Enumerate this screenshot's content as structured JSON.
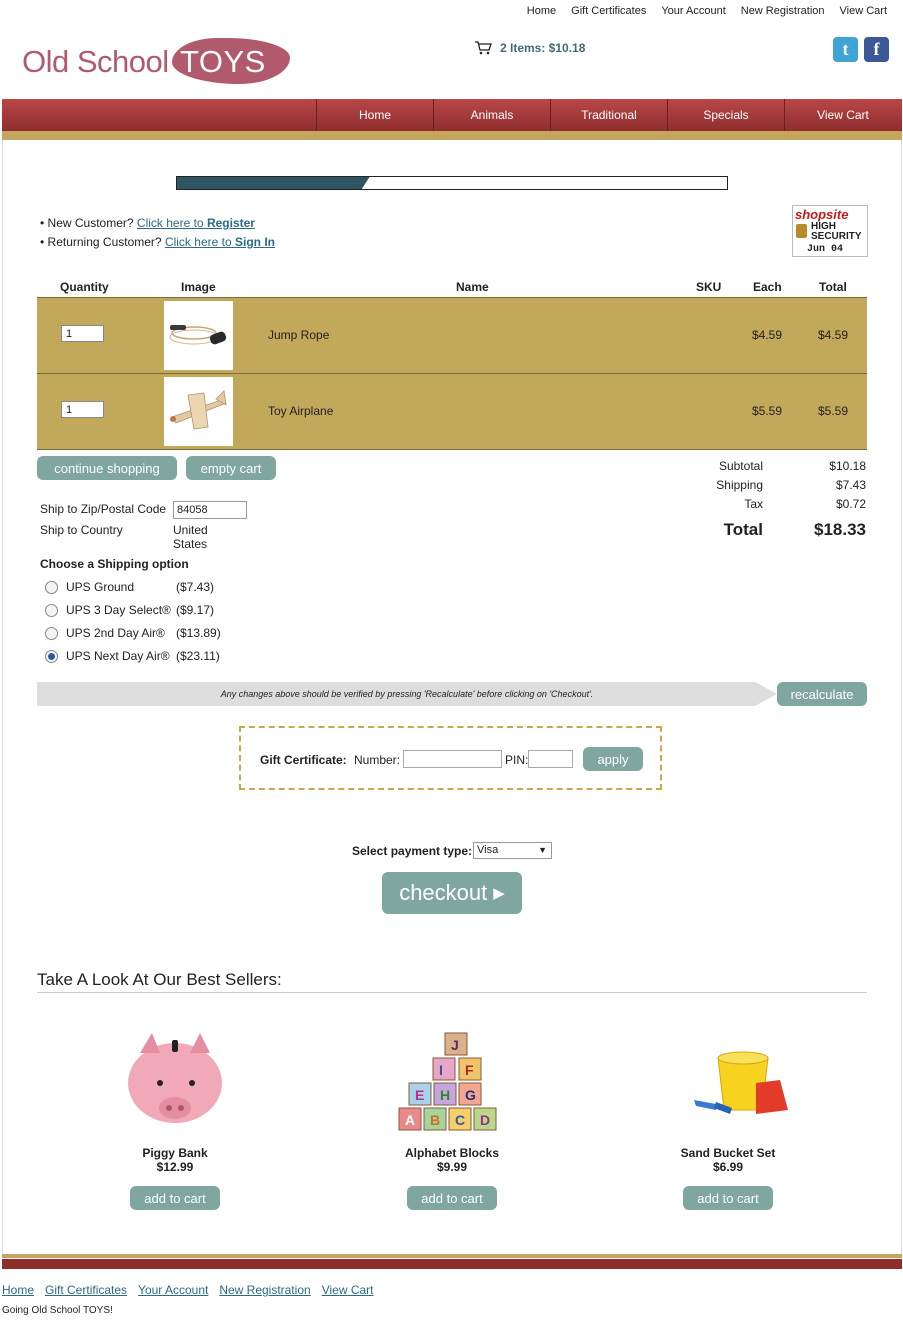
{
  "header": {
    "top_links": [
      "Home",
      "Gift Certificates",
      "Your Account",
      "New Registration",
      "View Cart"
    ],
    "logo_old": "Old School",
    "logo_toys": "TOYS",
    "cart_summary": "2 Items: $10.18"
  },
  "nav": [
    "Home",
    "Animals",
    "Traditional",
    "Specials",
    "View Cart"
  ],
  "progress": {
    "fraction": 0.35
  },
  "customer": {
    "new_prefix": "• New Customer?",
    "new_link": "Click here to",
    "new_link_bold": "Register",
    "return_prefix": "• Returning Customer?",
    "return_link": "Click here to",
    "return_link_bold": "Sign In"
  },
  "badge": {
    "brand": "shopsite",
    "line1": "HIGH",
    "line2": "SECURITY",
    "date": "Jun 04"
  },
  "table": {
    "headers": {
      "quantity": "Quantity",
      "image": "Image",
      "name": "Name",
      "sku": "SKU",
      "each": "Each",
      "total": "Total"
    },
    "rows": [
      {
        "qty": "1",
        "name": "Jump Rope",
        "each": "$4.59",
        "total": "$4.59"
      },
      {
        "qty": "1",
        "name": "Toy Airplane",
        "each": "$5.59",
        "total": "$5.59"
      }
    ]
  },
  "buttons": {
    "continue": "continue shopping",
    "empty": "empty cart",
    "recalculate": "recalculate",
    "apply": "apply",
    "checkout": "checkout"
  },
  "totals": {
    "subtotal_label": "Subtotal",
    "subtotal": "$10.18",
    "shipping_label": "Shipping",
    "shipping": "$7.43",
    "tax_label": "Tax",
    "tax": "$0.72",
    "total_label": "Total",
    "total": "$18.33"
  },
  "ship": {
    "zip_label": "Ship to Zip/Postal Code",
    "zip": "84058",
    "country_label": "Ship to Country",
    "country": "United States"
  },
  "shipping_options": {
    "title": "Choose a Shipping option",
    "options": [
      {
        "label": "UPS Ground",
        "price": "($7.43)"
      },
      {
        "label": "UPS 3 Day Select®",
        "price": "($9.17)"
      },
      {
        "label": "UPS 2nd Day Air®",
        "price": "($13.89)"
      },
      {
        "label": "UPS Next Day Air®",
        "price": "($23.11)"
      }
    ],
    "selected_index": 3
  },
  "recalc_note": "Any changes above should be verified by pressing 'Recalculate' before clicking on 'Checkout'.",
  "gift": {
    "label": "Gift Certificate:",
    "number_label": "Number:",
    "pin_label": "PIN:"
  },
  "payment": {
    "label": "Select payment type:",
    "selected": "Visa"
  },
  "bestsellers": {
    "title": "Take A Look At Our Best Sellers:",
    "add_label": "add to cart",
    "items": [
      {
        "name": "Piggy Bank",
        "price": "$12.99"
      },
      {
        "name": "Alphabet Blocks",
        "price": "$9.99"
      },
      {
        "name": "Sand Bucket Set",
        "price": "$6.99"
      }
    ]
  },
  "footer": {
    "links": [
      "Home",
      "Gift Certificates",
      "Your Account",
      "New Registration",
      "View Cart"
    ],
    "note": "Going Old School TOYS!"
  },
  "colors": {
    "nav": "#8f2d2d",
    "gold": "#c2a85a",
    "button": "#7fa79f",
    "link": "#2c6a85"
  }
}
